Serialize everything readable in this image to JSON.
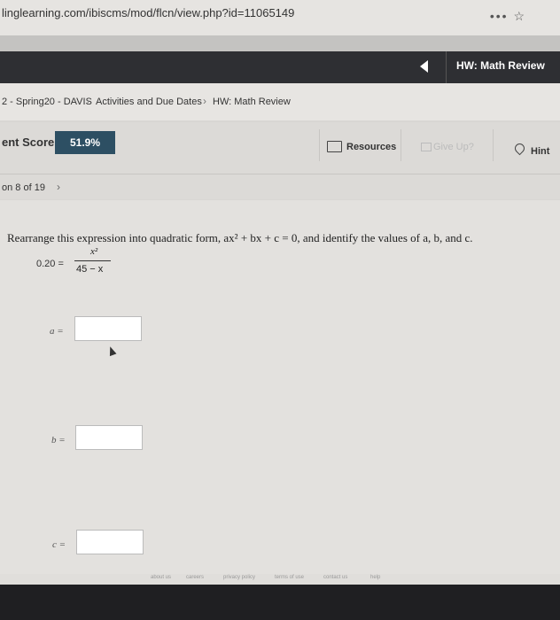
{
  "browser": {
    "url": "linglearning.com/ibiscms/mod/flcn/view.php?id=11065149",
    "menu_dots": "•••",
    "star": "☆"
  },
  "header": {
    "title": "HW: Math Review"
  },
  "breadcrumb": [
    "2 - Spring20 - DAVIS",
    "Activities and Due Dates",
    "HW: Math Review"
  ],
  "score": {
    "label": "ent Score:",
    "value": "51.9%"
  },
  "tools": {
    "resources": "Resources",
    "give_up": "Give Up?",
    "hint": "Hint"
  },
  "question_nav": {
    "label": "on 8 of 19",
    "next": "›"
  },
  "question": {
    "prompt": "Rearrange this expression into quadratic form, ax² + bx + c = 0, and identify the values of a, b, and c.",
    "lhs": "0.20 =",
    "numerator": "x²",
    "denominator": "45 − x"
  },
  "answers": [
    {
      "label": "a =",
      "value": ""
    },
    {
      "label": "b =",
      "value": ""
    },
    {
      "label": "c =",
      "value": ""
    }
  ],
  "footer": {
    "links": [
      "about us",
      "careers",
      "privacy policy",
      "terms of use",
      "contact us",
      "help"
    ]
  }
}
